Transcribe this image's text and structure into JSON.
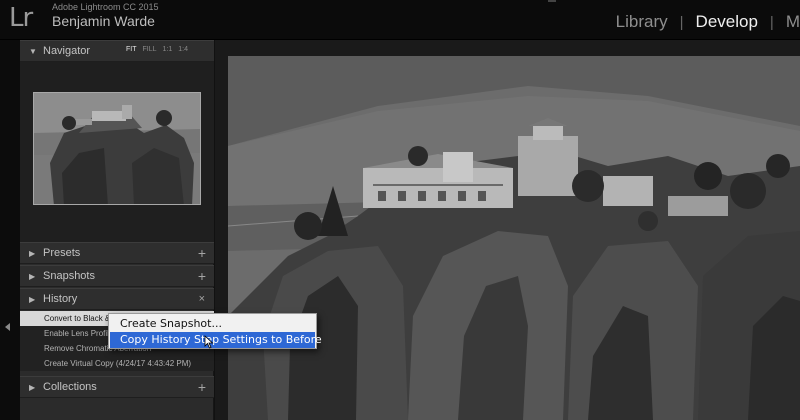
{
  "app": {
    "logo": "Lr",
    "name": "Adobe Lightroom CC 2015",
    "user": "Benjamin Warde"
  },
  "modules": [
    {
      "label": "Library",
      "active": false
    },
    {
      "label": "Develop",
      "active": true
    },
    {
      "label": "M",
      "active": false
    }
  ],
  "module_separator": "|",
  "navigator": {
    "title": "Navigator",
    "zoom_options": [
      "FIT",
      "FILL",
      "1:1",
      "1:4"
    ],
    "zoom_selected": "FIT"
  },
  "panels": {
    "presets": "Presets",
    "snapshots": "Snapshots",
    "history": "History",
    "collections": "Collections"
  },
  "history_items": [
    "Convert to Black & White",
    "Enable Lens Profile Corrections",
    "Remove Chromatic Aberration",
    "Create Virtual Copy (4/24/17 4:43:42 PM)"
  ],
  "context_menu": {
    "items": [
      {
        "label": "Create Snapshot...",
        "highlighted": false
      },
      {
        "label": "Copy History Step Settings to Before",
        "highlighted": true
      }
    ],
    "highlight_color": "#2e68d5"
  },
  "icons": {
    "plus": "+",
    "close": "×",
    "triangle_down": "▼",
    "triangle_right": "▶"
  },
  "colors": {
    "panel_bg": "#2b2b2b",
    "topbar_bg": "#0b0b0b",
    "active_module": "#efefef"
  }
}
